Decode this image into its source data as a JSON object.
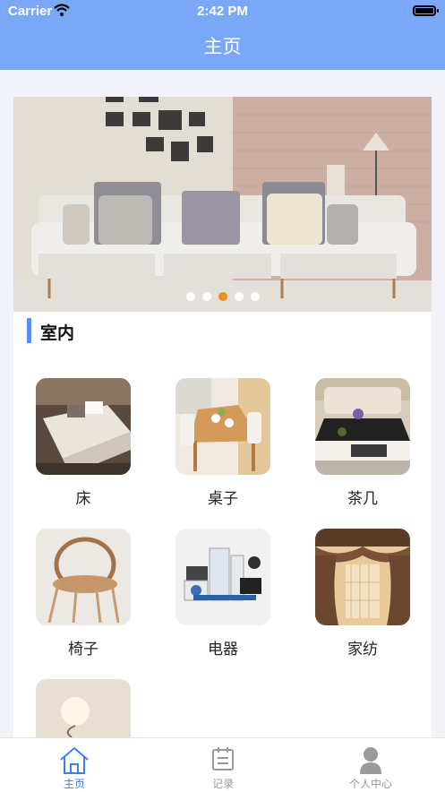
{
  "status_bar": {
    "carrier": "Carrier",
    "time": "2:42 PM"
  },
  "header": {
    "title": "主页"
  },
  "banner": {
    "slide_count": 5,
    "active_slide": 3
  },
  "section": {
    "title": "室内"
  },
  "categories": [
    {
      "label": "床",
      "icon": "bed-image"
    },
    {
      "label": "桌子",
      "icon": "dining-table-image"
    },
    {
      "label": "茶几",
      "icon": "coffee-table-image"
    },
    {
      "label": "椅子",
      "icon": "chair-image"
    },
    {
      "label": "电器",
      "icon": "appliances-image"
    },
    {
      "label": "家纺",
      "icon": "curtain-image"
    },
    {
      "label": "",
      "icon": "lamp-image"
    }
  ],
  "tabbar": {
    "items": [
      {
        "label": "主页",
        "icon": "home-icon",
        "active": true
      },
      {
        "label": "记录",
        "icon": "calendar-icon",
        "active": false
      },
      {
        "label": "个人中心",
        "icon": "person-icon",
        "active": false
      }
    ]
  },
  "colors": {
    "header": "#7aa7f6",
    "accent": "#3f7ef0",
    "active_dot": "#f28c1b"
  }
}
